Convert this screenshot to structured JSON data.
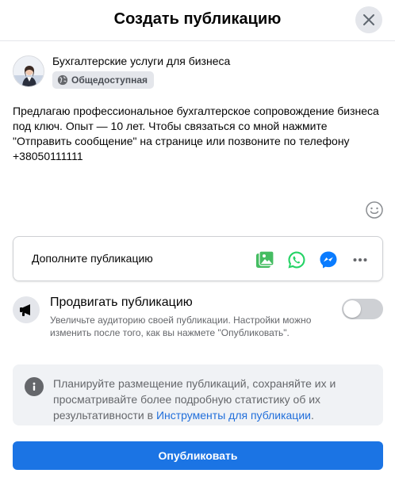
{
  "header": {
    "title": "Создать публикацию",
    "close_icon": "close-icon"
  },
  "author": {
    "name": "Бухгалтерские услуги для бизнеса",
    "privacy_label": "Общедоступная",
    "privacy_icon": "globe-icon"
  },
  "post": {
    "text": "Предлагаю профессиональное бухгалтерское сопровождение бизнеса под ключ. Опыт — 10 лет. Чтобы связаться со мной нажмите \"Отправить сообщение\" на странице или позвоните по телефону +38050111111",
    "emoji_icon": "smiley-icon"
  },
  "add_to_post": {
    "label": "Дополните публикацию",
    "icons": [
      "photo-video-icon",
      "whatsapp-icon",
      "messenger-icon",
      "more-icon"
    ]
  },
  "promote": {
    "title": "Продвигать публикацию",
    "description": "Увеличьте аудиторию своей публикации. Настройки можно изменить после того, как вы нажмете \"Опубликовать\".",
    "enabled": false,
    "icon": "megaphone-icon"
  },
  "info": {
    "text": "Планируйте размещение публикаций, сохраняйте их и просматривайте более подробную статистику об их результативности в ",
    "link": "Инструменты для публикации",
    "suffix": ".",
    "icon": "info-icon"
  },
  "publish_button": "Опубликовать",
  "colors": {
    "accent": "#1b74e4",
    "link": "#216fdb",
    "photo": "#45bd62",
    "whatsapp": "#25d366",
    "messenger": "#0a7cff",
    "secondary_text": "#65676b"
  }
}
